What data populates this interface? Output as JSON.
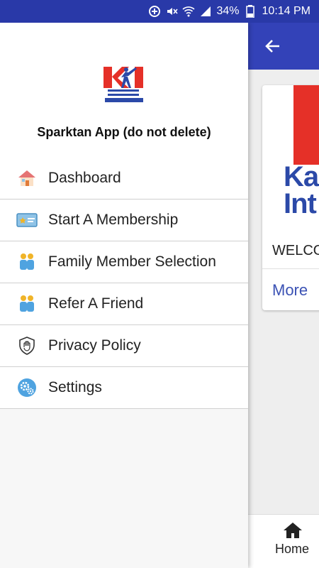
{
  "status_bar": {
    "battery": "34%",
    "time": "10:14 PM"
  },
  "drawer": {
    "logo_alt": "Karate International",
    "title": "Sparktan App (do not delete)",
    "items": [
      {
        "label": "Dashboard",
        "icon": "home-icon"
      },
      {
        "label": "Start A Membership",
        "icon": "membership-card-icon"
      },
      {
        "label": "Family Member Selection",
        "icon": "family-icon"
      },
      {
        "label": "Refer A Friend",
        "icon": "friends-icon"
      },
      {
        "label": "Privacy Policy",
        "icon": "shield-hand-icon"
      },
      {
        "label": "Settings",
        "icon": "settings-gears-icon"
      }
    ]
  },
  "background_app": {
    "card_logo_text_line1": "Ka",
    "card_logo_text_line2": "Int",
    "welcome_text": "WELCO",
    "more_link": "More",
    "bottom_nav_home": "Home"
  },
  "colors": {
    "primary": "#3342b8",
    "status_bar": "#2939a8",
    "accent_red": "#e53028",
    "logo_blue": "#2b49a8"
  }
}
